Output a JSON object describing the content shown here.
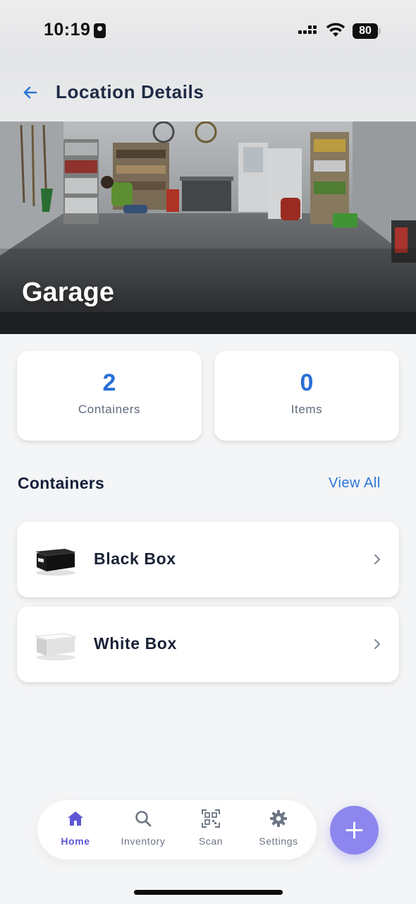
{
  "status_bar": {
    "time": "10:19",
    "battery": "80"
  },
  "header": {
    "title": "Location Details",
    "back_icon": "arrow-left-icon"
  },
  "hero": {
    "title": "Garage"
  },
  "stats": [
    {
      "value": "2",
      "label": "Containers"
    },
    {
      "value": "0",
      "label": "Items"
    }
  ],
  "containers_section": {
    "title": "Containers",
    "view_all_label": "View All",
    "items": [
      {
        "label": "Black Box",
        "icon": "black-box-icon"
      },
      {
        "label": "White Box",
        "icon": "white-box-icon"
      }
    ]
  },
  "tabbar": {
    "tabs": [
      {
        "label": "Home",
        "icon": "home-icon",
        "active": true
      },
      {
        "label": "Inventory",
        "icon": "search-icon",
        "active": false
      },
      {
        "label": "Scan",
        "icon": "qr-scan-icon",
        "active": false
      },
      {
        "label": "Settings",
        "icon": "gear-icon",
        "active": false
      }
    ]
  },
  "fab": {
    "icon": "plus-icon"
  },
  "colors": {
    "accent_blue": "#2a6fd6",
    "tab_active": "#5d57d6",
    "fab": "#8c86ee",
    "background": "#f4f5f6"
  }
}
